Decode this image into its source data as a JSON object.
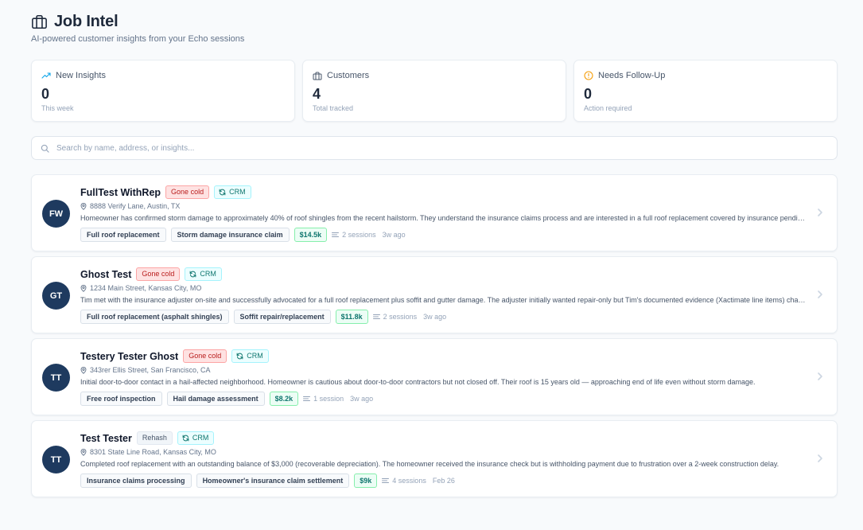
{
  "header": {
    "title": "Job Intel",
    "subtitle": "AI-powered customer insights from your Echo sessions"
  },
  "stats": [
    {
      "label": "New Insights",
      "value": "0",
      "sub": "This week",
      "icon": "trend-up-icon",
      "color": "#0ea5e9"
    },
    {
      "label": "Customers",
      "value": "4",
      "sub": "Total tracked",
      "icon": "briefcase-icon",
      "color": "#475569"
    },
    {
      "label": "Needs Follow-Up",
      "value": "0",
      "sub": "Action required",
      "icon": "alert-circle-icon",
      "color": "#f59e0b"
    }
  ],
  "search": {
    "placeholder": "Search by name, address, or insights..."
  },
  "customers": [
    {
      "initials": "FW",
      "name": "FullTest WithRep",
      "status": "Gone cold",
      "crm": "CRM",
      "address": "8888 Verify Lane, Austin, TX",
      "summary": "Homeowner has confirmed storm damage to approximately 40% of roof shingles from the recent hailstorm. They understand the insurance claims process and are interested in a full roof replacement covered by insurance pending adjuster approval.",
      "tags": [
        "Full roof replacement",
        "Storm damage insurance claim"
      ],
      "value": "$14.5k",
      "sessions": "2 sessions",
      "time": "3w ago"
    },
    {
      "initials": "GT",
      "name": "Ghost Test",
      "status": "Gone cold",
      "crm": "CRM",
      "address": "1234 Main Street, Kansas City, MO",
      "summary": "Tim met with the insurance adjuster on-site and successfully advocated for a full roof replacement plus soffit and gutter damage. The adjuster initially wanted repair-only but Tim's documented evidence (Xactimate line items) changed the outcome.",
      "tags": [
        "Full roof replacement (asphalt shingles)",
        "Soffit repair/replacement"
      ],
      "value": "$11.8k",
      "sessions": "2 sessions",
      "time": "3w ago"
    },
    {
      "initials": "TT",
      "name": "Testery Tester Ghost",
      "status": "Gone cold",
      "crm": "CRM",
      "address": "343rer Ellis Street, San Francisco, CA",
      "summary": "Initial door-to-door contact in a hail-affected neighborhood. Homeowner is cautious about door-to-door contractors but not closed off. Their roof is 15 years old — approaching end of life even without storm damage.",
      "tags": [
        "Free roof inspection",
        "Hail damage assessment"
      ],
      "value": "$8.2k",
      "sessions": "1 session",
      "time": "3w ago"
    },
    {
      "initials": "TT",
      "name": "Test Tester",
      "status": "Rehash",
      "crm": "CRM",
      "address": "8301 State Line Road, Kansas City, MO",
      "summary": "Completed roof replacement with an outstanding balance of $3,000 (recoverable depreciation). The homeowner received the insurance check but is withholding payment due to frustration over a 2-week construction delay.",
      "tags": [
        "Insurance claims processing",
        "Homeowner's insurance claim settlement"
      ],
      "value": "$9k",
      "sessions": "4 sessions",
      "time": "Feb 26"
    }
  ]
}
